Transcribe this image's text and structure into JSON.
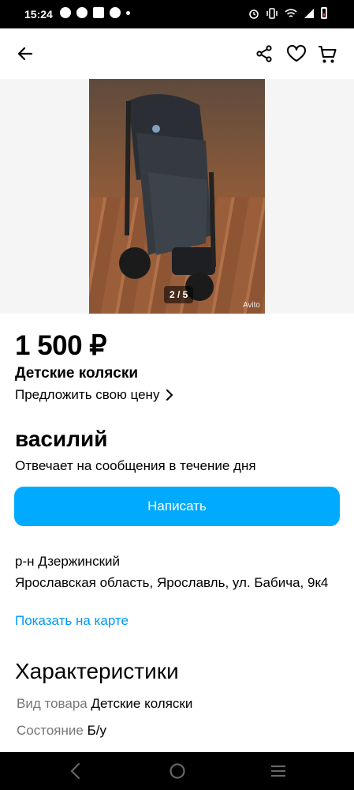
{
  "status_bar": {
    "time": "15:24",
    "left_icons": [
      "messenger-icon",
      "chat-icon",
      "fighter-app-icon",
      "facebook-icon",
      "dot-icon"
    ],
    "right_icons": [
      "alarm-icon",
      "vibrate-icon",
      "wifi-icon",
      "signal-icon",
      "battery-icon"
    ]
  },
  "app_bar": {
    "icons": [
      "back-arrow-icon",
      "share-icon",
      "heart-icon",
      "cart-icon"
    ]
  },
  "gallery": {
    "counter": "2 / 5",
    "watermark": "Avito"
  },
  "listing": {
    "price": "1 500 ₽",
    "category": "Детские коляски",
    "offer_link": "Предложить свою цену"
  },
  "seller": {
    "name": "василий",
    "response_time": "Отвечает на сообщения в течение дня",
    "write_button": "Написать"
  },
  "location": {
    "district": "р-н Дзержинский",
    "address": "Ярославская область, Ярославль, ул. Бабича, 9к4",
    "map_link": "Показать на карте"
  },
  "characteristics": {
    "title": "Характеристики",
    "rows": [
      {
        "key": "Вид товара",
        "value": "Детские коляски"
      },
      {
        "key": "Состояние",
        "value": "Б/у"
      }
    ]
  },
  "colors": {
    "accent": "#00aaff",
    "link": "#0099f7"
  }
}
